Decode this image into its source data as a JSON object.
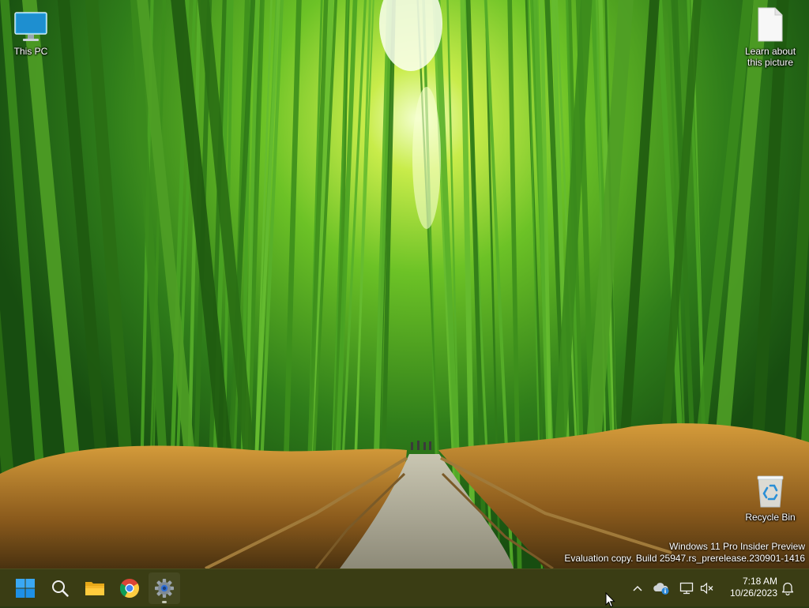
{
  "desktop": {
    "icons": [
      {
        "label": "This PC",
        "icon": "monitor-icon"
      },
      {
        "label": "Learn about this picture",
        "icon": "document-icon"
      },
      {
        "label": "Recycle Bin",
        "icon": "recycle-bin-icon"
      }
    ],
    "watermark": {
      "line1": "Windows 11 Pro Insider Preview",
      "line2": "Evaluation copy. Build 25947.rs_prerelease.230901-1416"
    }
  },
  "taskbar": {
    "apps": [
      {
        "name": "Start",
        "icon": "windows-logo-icon"
      },
      {
        "name": "Search",
        "icon": "search-icon"
      },
      {
        "name": "File Explorer",
        "icon": "folder-icon"
      },
      {
        "name": "Google Chrome",
        "icon": "chrome-icon"
      },
      {
        "name": "Settings",
        "icon": "gear-icon",
        "running": true
      }
    ],
    "tray": {
      "icons": [
        "chevron-up-icon",
        "onedrive-icon",
        "network-icon",
        "volume-muted-icon",
        "bell-icon"
      ],
      "time": "7:18 AM",
      "date": "10/26/2023"
    }
  },
  "colors": {
    "taskbar_bg": "#3a3d14",
    "windows_blue": "#1e90e6"
  }
}
